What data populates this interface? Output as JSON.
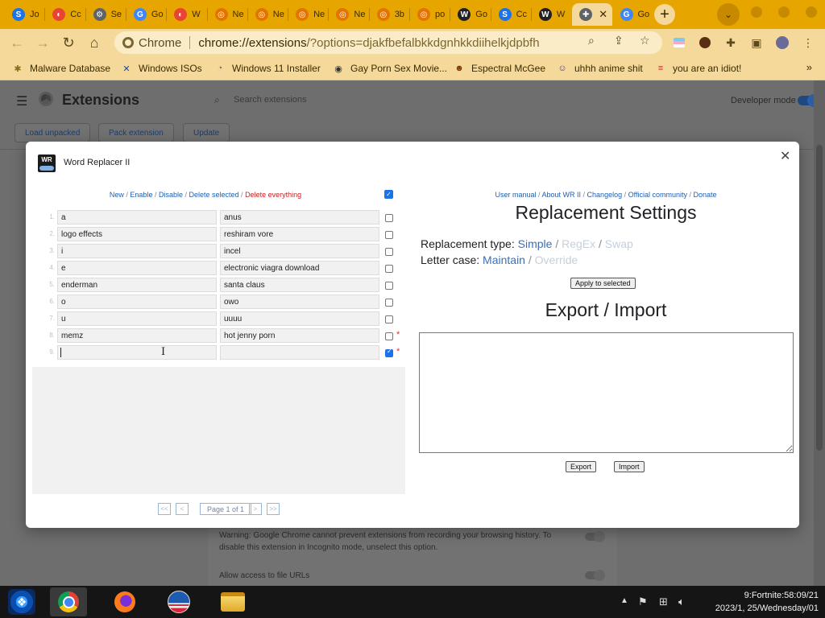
{
  "tabs": [
    {
      "label": "Jo",
      "icon": "s-icon",
      "color": "#1a73e8",
      "glyph": "S"
    },
    {
      "label": "Cc",
      "icon": "generic-icon",
      "color": "#ea4335",
      "glyph": "◐"
    },
    {
      "label": "Se",
      "icon": "gear-icon",
      "color": "#5f6368",
      "glyph": "⚙"
    },
    {
      "label": "Go",
      "icon": "google-icon",
      "color": "#4285f4",
      "glyph": "G"
    },
    {
      "label": "W",
      "icon": "generic-icon",
      "color": "#ea4335",
      "glyph": "◐"
    },
    {
      "label": "Ne",
      "icon": "globe-icon",
      "color": "#e37400",
      "glyph": "◎"
    },
    {
      "label": "Ne",
      "icon": "globe-icon",
      "color": "#e37400",
      "glyph": "◎"
    },
    {
      "label": "Ne",
      "icon": "globe-icon",
      "color": "#e37400",
      "glyph": "◎"
    },
    {
      "label": "Ne",
      "icon": "globe-icon",
      "color": "#e37400",
      "glyph": "◎"
    },
    {
      "label": "3b",
      "icon": "globe-icon",
      "color": "#e37400",
      "glyph": "◎"
    },
    {
      "label": "po",
      "icon": "globe-icon",
      "color": "#e37400",
      "glyph": "◎"
    },
    {
      "label": "Go",
      "icon": "wiki-icon",
      "color": "#202124",
      "glyph": "W"
    },
    {
      "label": "Cc",
      "icon": "s-icon",
      "color": "#1a73e8",
      "glyph": "S"
    },
    {
      "label": "W",
      "icon": "wiki-icon",
      "color": "#202124",
      "glyph": "W"
    },
    {
      "label": "",
      "icon": "puzzle-icon",
      "color": "#5f6368",
      "glyph": "✚",
      "active": true
    },
    {
      "label": "Go",
      "icon": "google-icon",
      "color": "#4285f4",
      "glyph": "G"
    }
  ],
  "toolbar": {
    "origin_label": "Chrome",
    "url_host": "chrome://extensions",
    "url_rest": "/?options=djakfbefalbkkdgnhkkdiihelkjdpbfh"
  },
  "bookmarks": [
    {
      "label": "Malware Database",
      "icon": "bug-icon"
    },
    {
      "label": "Windows ISOs",
      "icon": "x-icon"
    },
    {
      "label": "Windows 11 Installer",
      "icon": "installer-icon"
    },
    {
      "label": "Gay Porn Sex Movie...",
      "icon": "site-icon"
    },
    {
      "label": "Espectral McGee",
      "icon": "avatar-icon"
    },
    {
      "label": "uhhh anime shit",
      "icon": "anime-icon"
    },
    {
      "label": "you are an idiot!",
      "icon": "flag-icon"
    }
  ],
  "extensions_page": {
    "title": "Extensions",
    "search_placeholder": "Search extensions",
    "developer_mode_label": "Developer mode",
    "actions": [
      "Load unpacked",
      "Pack extension",
      "Update"
    ],
    "incognito_warning": "Warning: Google Chrome cannot prevent extensions from recording your browsing history. To disable this extension in Incognito mode, unselect this option.",
    "file_urls_label": "Allow access to file URLs"
  },
  "dialog": {
    "title": "Word Replacer II",
    "icon_text": "WR",
    "left_links": {
      "new": "New",
      "enable": "Enable",
      "disable": "Disable",
      "delete_selected": "Delete selected",
      "delete_everything": "Delete everything"
    },
    "rows": [
      {
        "num": "1.",
        "find": "a",
        "replace": "anus",
        "checked": false,
        "star": false
      },
      {
        "num": "2.",
        "find": "logo effects",
        "replace": "reshiram vore",
        "checked": false,
        "star": false
      },
      {
        "num": "3.",
        "find": "i",
        "replace": "incel",
        "checked": false,
        "star": false
      },
      {
        "num": "4.",
        "find": "e",
        "replace": "electronic viagra download",
        "checked": false,
        "star": false
      },
      {
        "num": "5.",
        "find": "enderman",
        "replace": "santa claus",
        "checked": false,
        "star": false
      },
      {
        "num": "6.",
        "find": "o",
        "replace": "owo",
        "checked": false,
        "star": false
      },
      {
        "num": "7.",
        "find": "u",
        "replace": "uuuu",
        "checked": false,
        "star": false
      },
      {
        "num": "8.",
        "find": "memz",
        "replace": "hot jenny porn",
        "checked": false,
        "star": true
      },
      {
        "num": "9.",
        "find": "",
        "replace": "",
        "checked": true,
        "star": true
      }
    ],
    "pager": {
      "first": "<<",
      "prev": "<",
      "label": "Page 1 of 1",
      "next": ">",
      "last": ">>"
    },
    "right_links": [
      "User manual",
      "About WR II",
      "Changelog",
      "Official community",
      "Donate"
    ],
    "replacement_settings": {
      "title": "Replacement Settings",
      "type_label": "Replacement type:",
      "type_options": [
        {
          "label": "Simple",
          "enabled": true
        },
        {
          "label": "RegEx",
          "enabled": false
        },
        {
          "label": "Swap",
          "enabled": false
        }
      ],
      "case_label": "Letter case:",
      "case_options": [
        {
          "label": "Maintain",
          "enabled": true
        },
        {
          "label": "Override",
          "enabled": false
        }
      ],
      "apply_button": "Apply to selected"
    },
    "export_import": {
      "title": "Export / Import",
      "textarea_value": "",
      "export_button": "Export",
      "import_button": "Import"
    }
  },
  "taskbar": {
    "clock_line1": "9:Fortnite:58:09/21",
    "clock_line2": "2023/1, 25/Wednesday/01"
  }
}
